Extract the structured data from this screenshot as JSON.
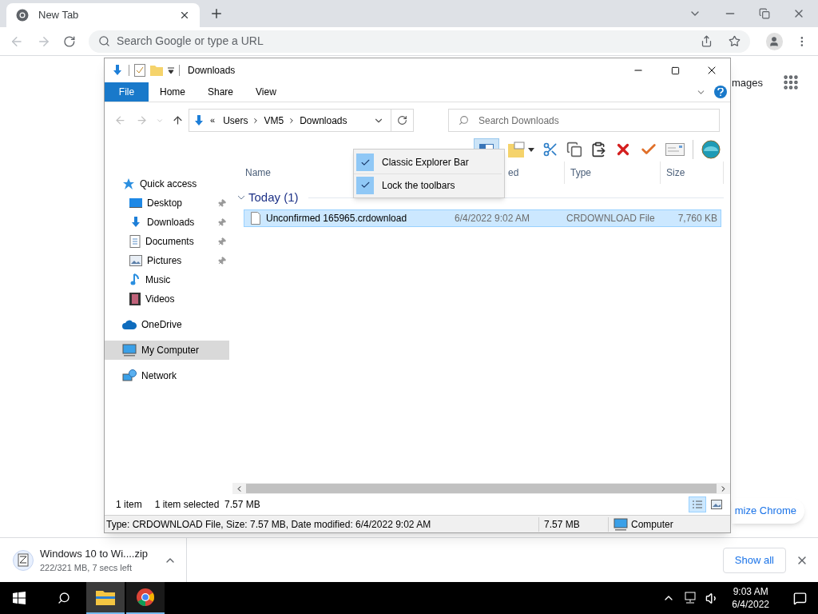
{
  "browser": {
    "tab": {
      "title": "New Tab"
    },
    "omnibox": {
      "placeholder": "Search Google or type a URL"
    }
  },
  "new_tab_page": {
    "images_link": "mages",
    "customize_button": "mize Chrome"
  },
  "explorer": {
    "title": "Downloads",
    "ribbon_tabs": [
      {
        "label": "File",
        "kind": "menu"
      },
      {
        "label": "Home",
        "kind": "tab"
      },
      {
        "label": "Share",
        "kind": "tab"
      },
      {
        "label": "View",
        "kind": "tab"
      }
    ],
    "breadcrumb_overflow": "«",
    "breadcrumb": [
      "Users",
      "VM5",
      "Downloads"
    ],
    "search": {
      "placeholder": "Search Downloads"
    },
    "toolbar": {
      "pane_button_pressed": true
    },
    "nav": [
      {
        "label": "Quick access",
        "selected": false,
        "children": [
          {
            "label": "Desktop",
            "pinned": true,
            "selected": false
          },
          {
            "label": "Downloads",
            "pinned": true,
            "selected": false
          },
          {
            "label": "Documents",
            "pinned": true,
            "selected": false
          },
          {
            "label": "Pictures",
            "pinned": true,
            "selected": false
          },
          {
            "label": "Music",
            "pinned": false,
            "selected": false
          },
          {
            "label": "Videos",
            "pinned": false,
            "selected": false
          }
        ]
      },
      {
        "label": "OneDrive",
        "selected": false
      },
      {
        "label": "My Computer",
        "selected": true
      },
      {
        "label": "Network",
        "selected": false
      }
    ],
    "columns": [
      {
        "label": "Name"
      },
      {
        "label": "ed"
      },
      {
        "label": "Type"
      },
      {
        "label": "Size"
      }
    ],
    "groups": [
      {
        "label": "Today (1)",
        "expanded": true,
        "rows": [
          {
            "name": "Unconfirmed 165965.crdownload",
            "date": "6/4/2022 9:02 AM",
            "type": "CRDOWNLOAD File",
            "size": "7,760 KB",
            "selected": true
          }
        ]
      }
    ],
    "status": {
      "count": "1 item",
      "selection": "1 item selected  7.57 MB"
    },
    "view_buttons": [
      {
        "selected": true
      },
      {
        "selected": false
      }
    ],
    "classic_status": {
      "info": "Type: CRDOWNLOAD File, Size: 7.57 MB, Date modified: 6/4/2022 9:02 AM",
      "size": "7.57 MB",
      "zone": "Computer"
    },
    "context_menu": [
      {
        "label": "Classic Explorer Bar",
        "checked": true
      },
      {
        "label": "Lock the toolbars",
        "checked": true
      }
    ]
  },
  "download_shelf": {
    "items": [
      {
        "name": "Windows 10 to Wi....zip",
        "status": "222/321 MB, 7 secs left"
      }
    ],
    "show_all": "Show all"
  },
  "taskbar": {
    "apps": [
      {
        "selected": true
      },
      {
        "selected": false
      }
    ],
    "time": "9:03 AM",
    "date": "6/4/2022"
  }
}
